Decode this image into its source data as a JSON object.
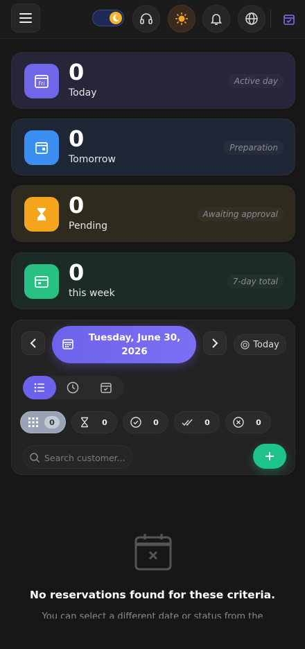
{
  "header": {
    "icons": [
      "menu-icon",
      "moon-icon",
      "headset-icon",
      "sun-icon",
      "bell-icon",
      "globe-icon",
      "calendar-check-icon"
    ]
  },
  "stats": [
    {
      "count": "0",
      "label": "Today",
      "tag": "Active day",
      "icon_text": "Fri",
      "icon_color": "#7067e8",
      "bg": "#25253a"
    },
    {
      "count": "0",
      "label": "Tomorrow",
      "tag": "Preparation",
      "icon_color": "#3b8ff0",
      "bg": "#1f2736"
    },
    {
      "count": "0",
      "label": "Pending",
      "tag": "Awaiting approval",
      "icon_color": "#f4a51c",
      "bg": "#2f2a1e"
    },
    {
      "count": "0",
      "label": "this week",
      "tag": "7-day total",
      "icon_color": "#27c184",
      "bg": "#1c2b25"
    }
  ],
  "filters": {
    "date_label": "Tuesday, June 30, 2026",
    "today_label": "Today",
    "statuses": [
      {
        "icon": "grid-icon",
        "count": "0",
        "active": true
      },
      {
        "icon": "hourglass-icon",
        "count": "0"
      },
      {
        "icon": "check-circle-icon",
        "count": "0"
      },
      {
        "icon": "double-check-icon",
        "count": "0"
      },
      {
        "icon": "x-circle-icon",
        "count": "0"
      }
    ],
    "search_placeholder": "Search customer...",
    "add_label": "+"
  },
  "empty_state": {
    "title": "No reservations found for these criteria.",
    "subtitle": "You can select a different date or status from the"
  },
  "colors": {
    "accent": "#6d62ec",
    "success": "#1ec48a",
    "background": "#171717"
  }
}
